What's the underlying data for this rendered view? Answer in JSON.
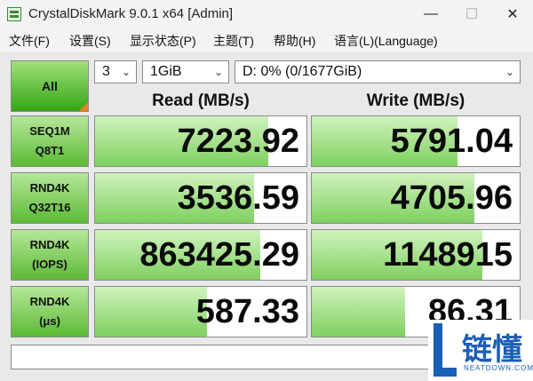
{
  "window": {
    "title": "CrystalDiskMark 9.0.1 x64 [Admin]",
    "minimize_glyph": "—",
    "maximize_glyph": "☐",
    "close_glyph": "✕"
  },
  "menu": [
    {
      "label": "文件(F)"
    },
    {
      "label": "设置(S)"
    },
    {
      "label": "显示状态(P)"
    },
    {
      "label": "主题(T)"
    },
    {
      "label": "帮助(H)"
    },
    {
      "label": "语言(L)(Language)"
    }
  ],
  "controls": {
    "all_label": "All",
    "count_value": "3",
    "size_value": "1GiB",
    "drive_value": "D: 0% (0/1677GiB)"
  },
  "headers": {
    "read": "Read (MB/s)",
    "write": "Write (MB/s)"
  },
  "tests": [
    {
      "line1": "SEQ1M",
      "line2": "Q8T1",
      "read": "7223.92",
      "write": "5791.04",
      "read_fill": 0.82,
      "write_fill": 0.7
    },
    {
      "line1": "RND4K",
      "line2": "Q32T16",
      "read": "3536.59",
      "write": "4705.96",
      "read_fill": 0.75,
      "write_fill": 0.78
    },
    {
      "line1": "RND4K",
      "line2": "(IOPS)",
      "read": "863425.29",
      "write": "1148915",
      "read_fill": 0.78,
      "write_fill": 0.82
    },
    {
      "line1": "RND4K",
      "line2": "(μs)",
      "read": "587.33",
      "write": "86.31",
      "read_fill": 0.53,
      "write_fill": 0.45
    }
  ],
  "status_text": "",
  "watermark": {
    "brand": "链懂",
    "domain": "NEATDOWN.COM"
  },
  "colors": {
    "accent_green": "#35a515",
    "bar_green": "#7fd060",
    "logo_blue": "#1a5fb8"
  }
}
